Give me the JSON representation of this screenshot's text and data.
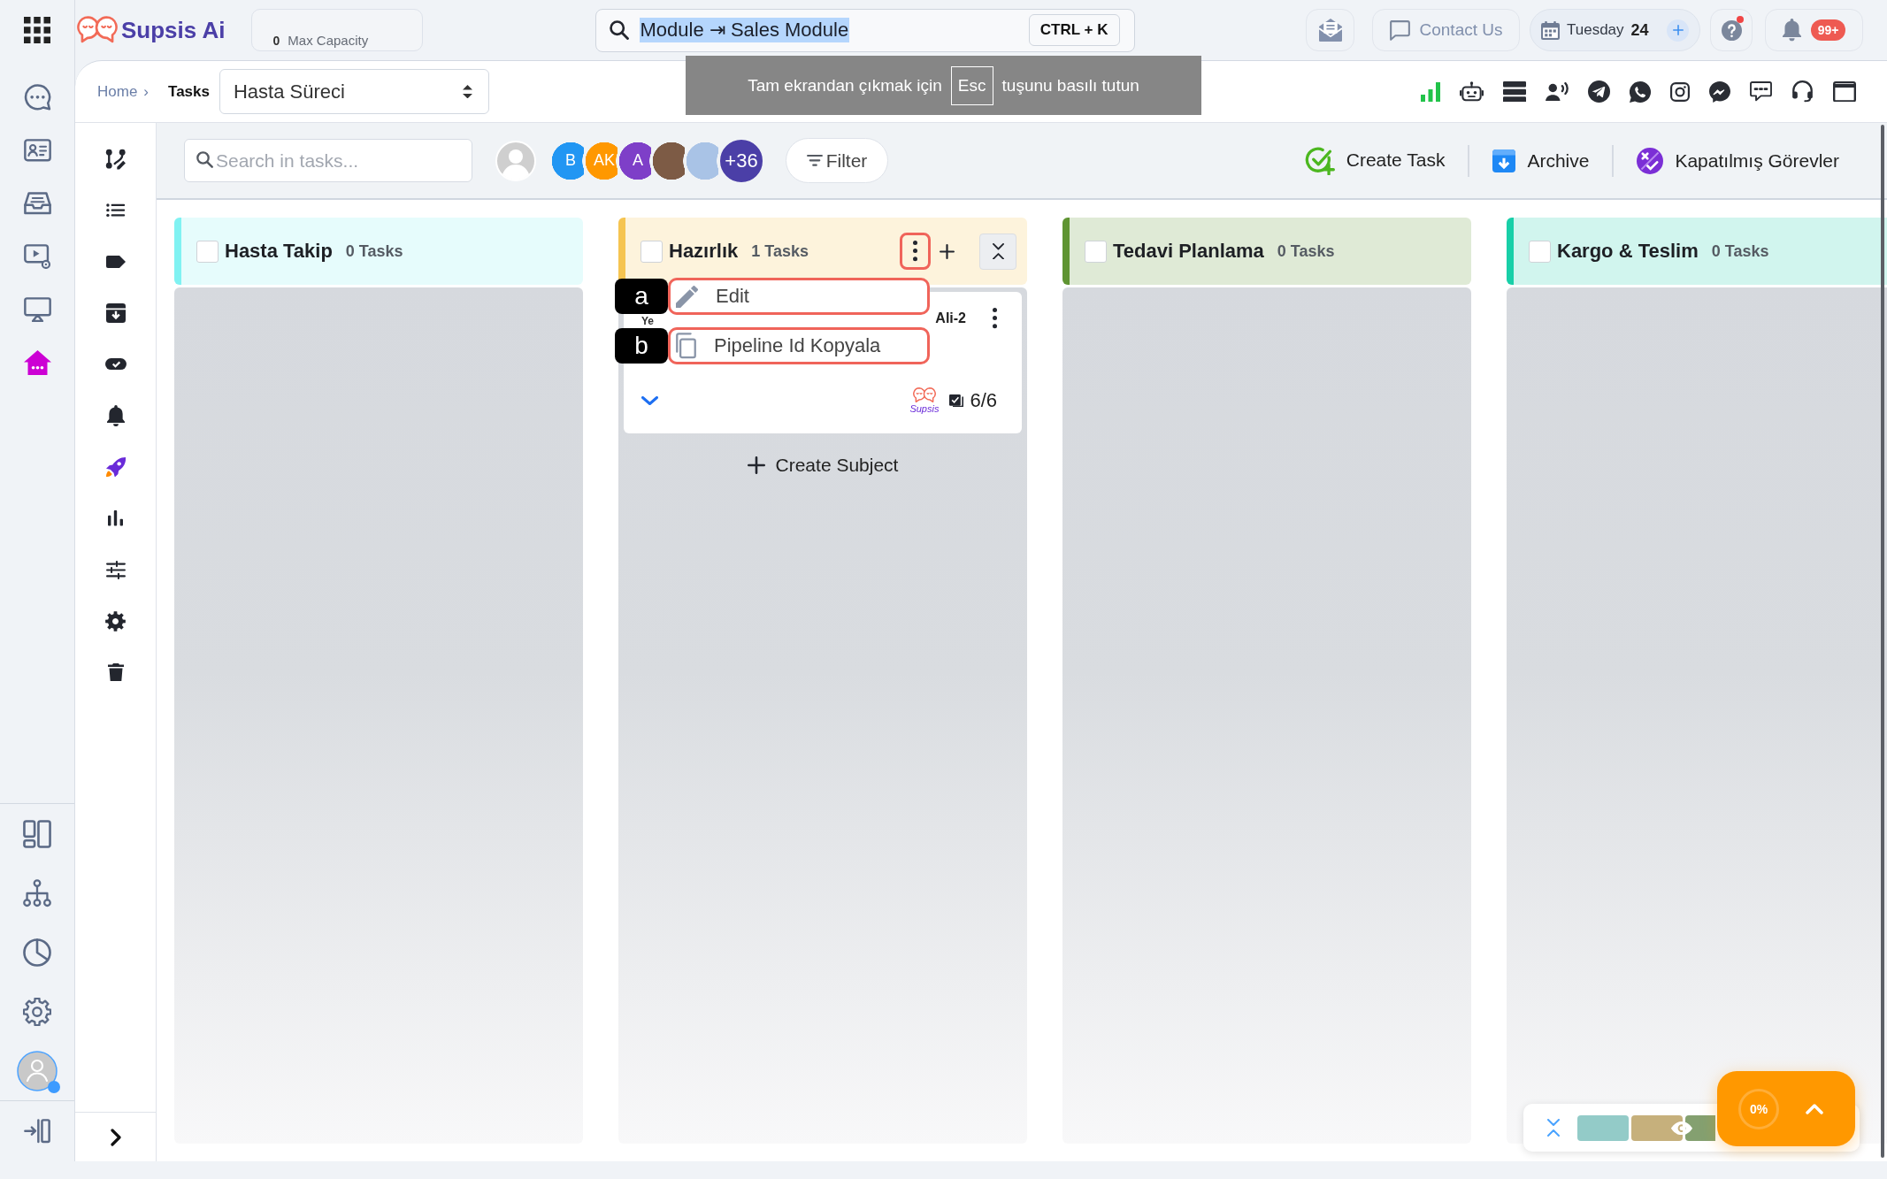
{
  "topbar": {
    "logo": "Supsis Ai",
    "capacity": {
      "count": "0",
      "label": "Max Capacity"
    },
    "search": {
      "value": "Module ⇥ Sales Module",
      "value_selected": true,
      "shortcut": "CTRL + K"
    },
    "contact": "Contact Us",
    "date": {
      "weekday": "Tuesday",
      "day": "24"
    },
    "help": {
      "alert": true
    },
    "notifications": {
      "badge": "99+"
    }
  },
  "fullscreen_notice": {
    "before": "Tam ekrandan çıkmak için",
    "key": "Esc",
    "after": "tuşunu basılı tutun"
  },
  "rail": {
    "items": [
      {
        "selected": false
      },
      {
        "selected": false
      },
      {
        "selected": false
      },
      {
        "selected": false
      },
      {
        "selected": false
      },
      {
        "selected": true
      }
    ],
    "profile": {
      "online": true
    }
  },
  "breadcrumb": {
    "home": "Home",
    "separator": "›",
    "current": "Tasks"
  },
  "pipeline_select": {
    "value": "Hasta Süreci"
  },
  "task_toolbar": {
    "search_placeholder": "Search in tasks...",
    "members": [
      {
        "kind": "placeholder"
      },
      {
        "kind": "initials",
        "initials": "B",
        "color": "#2196f3"
      },
      {
        "kind": "initials",
        "initials": "AK",
        "color": "#ff9800"
      },
      {
        "kind": "initials",
        "initials": "A",
        "color": "#7e3fc8"
      },
      {
        "kind": "photo",
        "color": "#7d5b45"
      },
      {
        "kind": "photo",
        "color": "#a9c3e6"
      }
    ],
    "more_members": "+36",
    "filter": "Filter",
    "actions": [
      {
        "kind": "create",
        "label": "Create Task"
      },
      {
        "kind": "archive",
        "label": "Archive"
      },
      {
        "kind": "closed",
        "label": "Kapatılmış Görevler"
      }
    ]
  },
  "columns": [
    {
      "title": "Hasta Takip",
      "count": "0 Tasks",
      "color": "#80f2f2",
      "checked": false,
      "hovered": false
    },
    {
      "title": "Hazırlık",
      "count": "1 Tasks",
      "color": "#f5c451",
      "checked": false,
      "hovered": true,
      "menu": {
        "highlighted": true,
        "items": [
          {
            "kind": "edit",
            "label": "Edit",
            "marker": "a",
            "highlighted": true
          },
          {
            "kind": "copy",
            "label": "Pipeline Id Kopyala",
            "marker": "b",
            "highlighted": true
          }
        ]
      },
      "cards": [
        {
          "title": "Ye",
          "code": "Ali-2",
          "source": "Supsis",
          "checklist": "6/6",
          "expanded": false
        }
      ],
      "create_subject": "Create Subject"
    },
    {
      "title": "Tedavi Planlama",
      "count": "0 Tasks",
      "color": "#5f9432",
      "checked": false,
      "hovered": false
    },
    {
      "title": "Kargo & Teslim",
      "count": "0 Tasks",
      "color": "#18cfa8",
      "checked": false,
      "hovered": false
    }
  ],
  "progress_widget": {
    "label": "0%",
    "minimap": [
      {
        "color": "#93cbc8"
      },
      {
        "color": "#c6b07c"
      },
      {
        "color": "#84a070"
      }
    ]
  }
}
